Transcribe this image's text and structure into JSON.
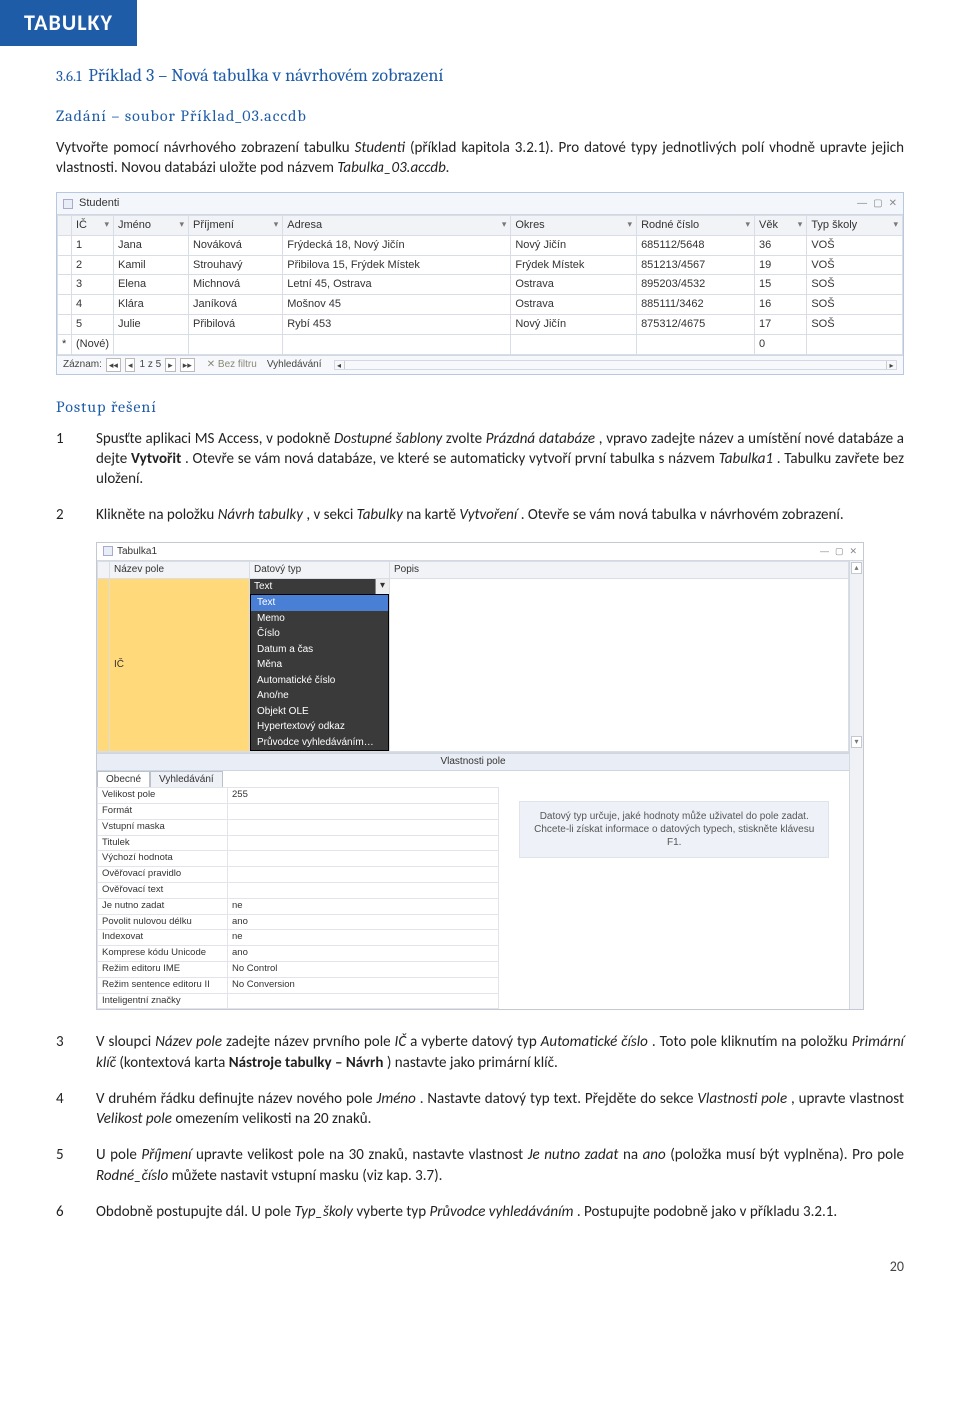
{
  "chapter_banner": "TABULKY",
  "section_number": "3.6.1",
  "section_title": "Příklad 3 – Nová tabulka v návrhovém zobrazení",
  "assignment_head": "Zadání – soubor Příklad_03.accdb",
  "assignment_p1_pre": "Vytvořte pomocí návrhového zobrazení tabulku ",
  "assignment_p1_it1": "Studenti",
  "assignment_p1_mid": " (příklad kapitola 3.2.1). Pro datové typy jednotlivých polí vhodně upravte jejich vlastnosti. Novou databázi uložte pod názvem ",
  "assignment_p1_it2": "Tabulka_03.accdb.",
  "shot1": {
    "title": "Studenti",
    "headers": [
      "",
      "IČ",
      "Jméno",
      "Příjmení",
      "Adresa",
      "Okres",
      "Rodné číslo",
      "Věk",
      "Typ školy"
    ],
    "rows": [
      [
        "",
        "1",
        "Jana",
        "Nováková",
        "Frýdecká 18, Nový Jičín",
        "Nový Jičín",
        "685112/5648",
        "36",
        "VOŠ"
      ],
      [
        "",
        "2",
        "Kamil",
        "Strouhavý",
        "Přibilova 15, Frýdek Místek",
        "Frýdek Místek",
        "851213/4567",
        "19",
        "VOŠ"
      ],
      [
        "",
        "3",
        "Elena",
        "Michnová",
        "Letní 45, Ostrava",
        "Ostrava",
        "895203/4532",
        "15",
        "SOŠ"
      ],
      [
        "",
        "4",
        "Klára",
        "Janíková",
        "Mošnov 45",
        "Ostrava",
        "885111/3462",
        "16",
        "SOŠ"
      ],
      [
        "",
        "5",
        "Julie",
        "Přibilová",
        "Rybí 453",
        "Nový Jičín",
        "875312/4675",
        "17",
        "SOŠ"
      ]
    ],
    "new_row": [
      "*",
      "(Nové)",
      "",
      "",
      "",
      "",
      "",
      "0",
      ""
    ],
    "status_prefix": "Záznam:",
    "status_pos": "1 z 5",
    "status_nofilter": "Bez filtru",
    "status_search": "Vyhledávání"
  },
  "solution_head": "Postup řešení",
  "steps": {
    "1": {
      "pre": "Spusťte aplikaci MS Access, v podokně ",
      "it1": "Dostupné šablony",
      "mid1": " zvolte ",
      "it2": "Prázdná databáze",
      "mid2": ", vpravo zadejte název a umístění nové databáze a dejte ",
      "b1": "Vytvořit",
      "mid3": ". Otevře se vám nová databáze, ve které se automaticky vytvoří první tabulka s názvem ",
      "it3": "Tabulka1",
      "post": ". Tabulku zavřete bez uložení."
    },
    "2": {
      "pre": "Klikněte na položku ",
      "it1": "Návrh tabulky",
      "mid1": ", v sekci ",
      "it2": "Tabulky",
      "mid2": " na kartě ",
      "it3": "Vytvoření",
      "post": ". Otevře se vám nová tabulka v návrhovém zobrazení."
    }
  },
  "shot2": {
    "title": "Tabulka1",
    "design_headers": [
      "Název pole",
      "Datový typ",
      "Popis"
    ],
    "row_field": "IČ",
    "row_type": "Text",
    "dropdown": [
      "Text",
      "Memo",
      "Číslo",
      "Datum a čas",
      "Měna",
      "Automatické číslo",
      "Ano/ne",
      "Objekt OLE",
      "Hypertextový odkaz",
      "Průvodce vyhledáváním…"
    ],
    "props_caption": "Vlastnosti pole",
    "tab_general": "Obecné",
    "tab_lookup": "Vyhledávání",
    "prop_rows": [
      [
        "Velikost pole",
        "255"
      ],
      [
        "Formát",
        ""
      ],
      [
        "Vstupní maska",
        ""
      ],
      [
        "Titulek",
        ""
      ],
      [
        "Výchozí hodnota",
        ""
      ],
      [
        "Ověřovací pravidlo",
        ""
      ],
      [
        "Ověřovací text",
        ""
      ],
      [
        "Je nutno zadat",
        "ne"
      ],
      [
        "Povolit nulovou délku",
        "ano"
      ],
      [
        "Indexovat",
        "ne"
      ],
      [
        "Komprese kódu Unicode",
        "ano"
      ],
      [
        "Režim editoru IME",
        "No Control"
      ],
      [
        "Režim sentence editoru II",
        "No Conversion"
      ],
      [
        "Inteligentní značky",
        ""
      ]
    ],
    "side_text": "Datový typ určuje, jaké hodnoty může uživatel do pole zadat. Chcete-li získat informace o datových typech, stiskněte klávesu F1."
  },
  "steps2": {
    "3": {
      "pre": "V sloupci ",
      "it1": "Název pole",
      "mid1": " zadejte název prvního pole ",
      "it2": "IČ",
      "mid2": " a vyberte datový typ ",
      "it3": "Automatické číslo",
      "mid3": ". Toto pole kliknutím na položku ",
      "it4": "Primární klíč",
      "mid4": " (kontextová karta ",
      "b1": "Nástroje tabulky – Návrh",
      "post": ") nastavte jako primární klíč."
    },
    "4": {
      "pre": "V druhém řádku definujte název nového pole ",
      "it1": "Jméno",
      "mid1": ". Nastavte datový typ text. Přejděte do sekce ",
      "it2": "Vlastnosti pole",
      "mid2": ", upravte vlastnost ",
      "it3": "Velikost pole",
      "post": " omezením velikosti na 20 znaků."
    },
    "5": {
      "pre": "U pole ",
      "it1": "Příjmení",
      "mid1": " upravte velikost pole na 30 znaků, nastavte vlastnost ",
      "it2": "Je nutno zadat",
      "mid2": " na ",
      "it3": "ano",
      "mid3": " (položka musí být vyplněna). Pro pole ",
      "it4": "Rodné_číslo",
      "post": " můžete nastavit vstupní masku (viz kap. 3.7)."
    },
    "6": {
      "pre": "Obdobně postupujte dál. U pole ",
      "it1": "Typ_školy",
      "mid1": " vyberte typ ",
      "it2": "Průvodce vyhledáváním",
      "post": ". Postupujte podobně jako v příkladu 3.2.1."
    }
  },
  "page_number": "20"
}
